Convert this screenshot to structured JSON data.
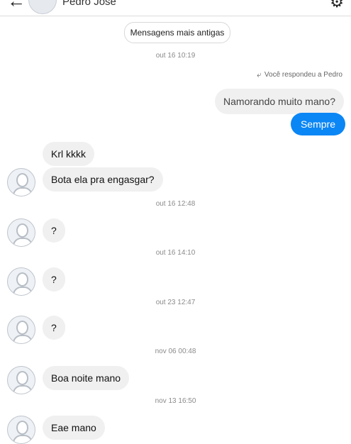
{
  "header": {
    "contact_name": "Pedro José",
    "back_icon": "arrow-left-icon",
    "settings_icon": "gear-icon"
  },
  "older_messages_label": "Mensagens mais antigas",
  "timestamps": [
    "out 16 10:19",
    "out 16 12:48",
    "out 16 14:10",
    "out 23 12:47",
    "nov 06 00:48",
    "nov 13 16:50"
  ],
  "reply_note": "Você respondeu a Pedro",
  "outgoing": {
    "quoted_message": "Namorando muito mano?",
    "reply": "Sempre"
  },
  "incoming": [
    "Krl kkkk",
    "Bota ela pra engasgar?",
    "?",
    "?",
    "?",
    "Boa noite mano",
    "Eae mano"
  ],
  "colors": {
    "accent_blue": "#0b86f5",
    "bubble_gray": "#f0f0f0"
  }
}
